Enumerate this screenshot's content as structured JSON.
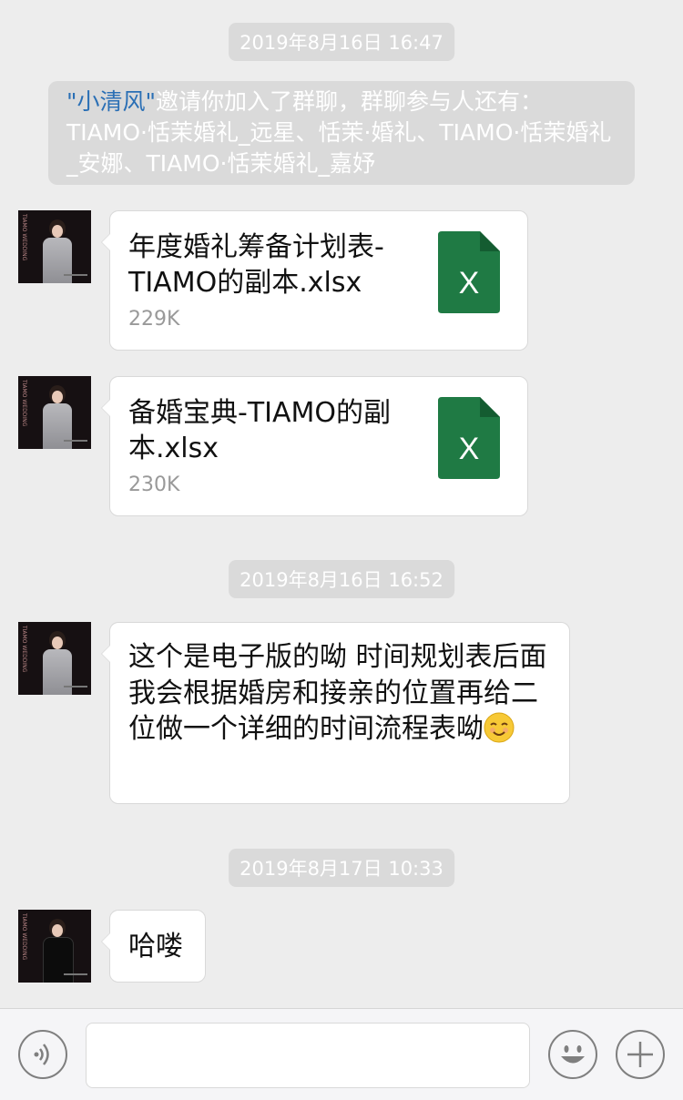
{
  "timestamps": {
    "t1": "2019年8月16日 16:47",
    "t2": "2019年8月16日 16:52",
    "t3": "2019年8月17日 10:33"
  },
  "system_notice": {
    "inviter": "\"小清风\"",
    "text": "邀请你加入了群聊，群聊参与人还有：TIAMO·恬茉婚礼_远星、恬茉·婚礼、TIAMO·恬茉婚礼_安娜、TIAMO·恬茉婚礼_嘉妤"
  },
  "messages": [
    {
      "type": "file",
      "file_name": "年度婚礼筹备计划表-TIAMO的副本.xlsx",
      "file_size": "229K",
      "icon": "excel-file-icon",
      "icon_letter": "X"
    },
    {
      "type": "file",
      "file_name": "备婚宝典-TIAMO的副本.xlsx",
      "file_size": "230K",
      "icon": "excel-file-icon",
      "icon_letter": "X"
    },
    {
      "type": "text",
      "text": "这个是电子版的呦 时间规划表后面我会根据婚房和接亲的位置再给二位做一个详细的时间流程表呦",
      "emoji": "smiling-face-emoji"
    },
    {
      "type": "text",
      "text": "哈喽"
    }
  ],
  "avatar": {
    "brand_text": "TIAMO WEDDING"
  },
  "input_bar": {
    "voice_icon": "voice-icon",
    "emoji_icon": "emoji-icon",
    "plus_icon": "plus-icon",
    "input_value": ""
  },
  "colors": {
    "background": "#ededed",
    "bubble": "#ffffff",
    "timestamp_bg": "#dadada",
    "excel_green": "#1f7a44",
    "inviter_link": "#2a6fb5"
  }
}
